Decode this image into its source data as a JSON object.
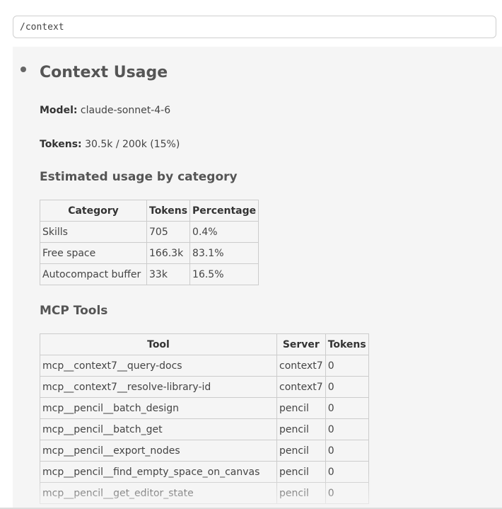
{
  "prompt": {
    "value": "/context"
  },
  "report": {
    "title": "Context Usage",
    "model_label": "Model:",
    "model_value": "claude-sonnet-4-6",
    "tokens_label": "Tokens:",
    "tokens_value": "30.5k / 200k (15%)",
    "category_heading": "Estimated usage by category",
    "category_table": {
      "headers": [
        "Category",
        "Tokens",
        "Percentage"
      ],
      "rows": [
        [
          "Skills",
          "705",
          "0.4%"
        ],
        [
          "Free space",
          "166.3k",
          "83.1%"
        ],
        [
          "Autocompact buffer",
          "33k",
          "16.5%"
        ]
      ]
    },
    "mcp_heading": "MCP Tools",
    "mcp_table": {
      "headers": [
        "Tool",
        "Server",
        "Tokens"
      ],
      "rows": [
        [
          "mcp__context7__query-docs",
          "context7",
          "0"
        ],
        [
          "mcp__context7__resolve-library-id",
          "context7",
          "0"
        ],
        [
          "mcp__pencil__batch_design",
          "pencil",
          "0"
        ],
        [
          "mcp__pencil__batch_get",
          "pencil",
          "0"
        ],
        [
          "mcp__pencil__export_nodes",
          "pencil",
          "0"
        ],
        [
          "mcp__pencil__find_empty_space_on_canvas",
          "pencil",
          "0"
        ],
        [
          "mcp__pencil__get_editor_state",
          "pencil",
          "0"
        ]
      ]
    }
  }
}
